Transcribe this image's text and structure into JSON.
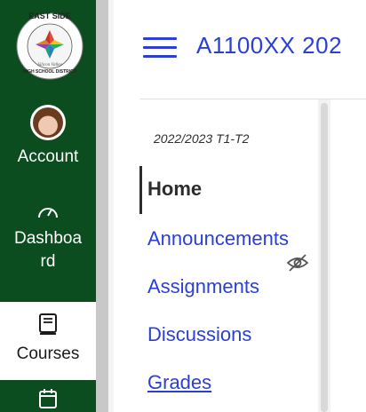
{
  "logo": {
    "top_text": "EAST SIDE",
    "script_text": "Silicon Valley",
    "bottom_text": "HIGH SCHOOL DISTRICT"
  },
  "global_nav": {
    "account_label": "Account",
    "dashboard_label_line1": "Dashboa",
    "dashboard_label_line2": "rd",
    "courses_label": "Courses",
    "calendar_icon": "calendar-icon",
    "colors": {
      "nav_bg": "#0b4d1f",
      "active_bg": "#ffffff"
    }
  },
  "header": {
    "course_title": "A1100XX 202",
    "menu_icon": "hamburger-icon"
  },
  "course_nav": {
    "term": "2022/2023 T1-T2",
    "items": [
      {
        "label": "Home",
        "active": true
      },
      {
        "label": "Announcements"
      },
      {
        "label": "Assignments",
        "hidden_icon": "eye-slash-icon"
      },
      {
        "label": "Discussions"
      },
      {
        "label": "Grades"
      }
    ]
  },
  "colors": {
    "link": "#2b3fd3",
    "text": "#2d2d2d"
  }
}
